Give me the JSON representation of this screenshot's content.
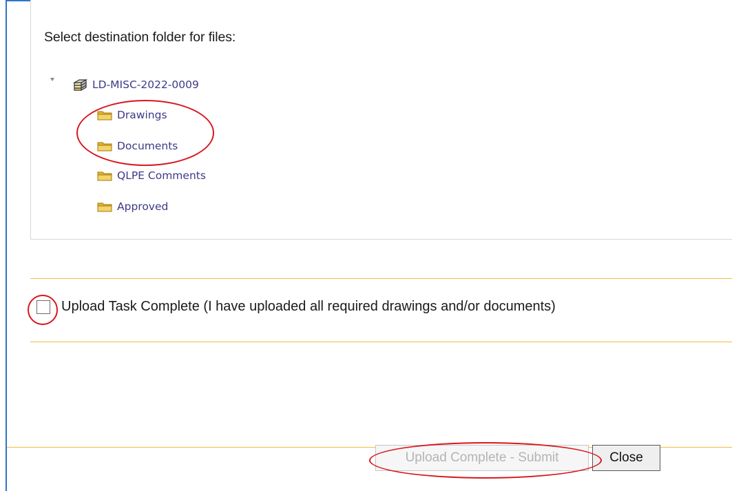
{
  "instruction": "Select destination folder for files:",
  "tree": {
    "root": {
      "label": "LD-MISC-2022-0009",
      "icon": "database-icon"
    },
    "folders": [
      {
        "label": "Drawings",
        "icon": "folder-icon"
      },
      {
        "label": "Documents",
        "icon": "folder-icon"
      },
      {
        "label": "QLPE Comments",
        "icon": "folder-icon"
      },
      {
        "label": "Approved",
        "icon": "folder-icon"
      }
    ]
  },
  "checkbox": {
    "label": "Upload Task Complete (I have uploaded all required drawings and/or documents)",
    "checked": false
  },
  "buttons": {
    "submit_label": "Upload Complete - Submit",
    "submit_disabled": true,
    "close_label": "Close"
  },
  "colors": {
    "link": "#3c3a86",
    "divider": "#f5b942",
    "frame": "#2e74c9",
    "annotation": "#d8161c"
  }
}
